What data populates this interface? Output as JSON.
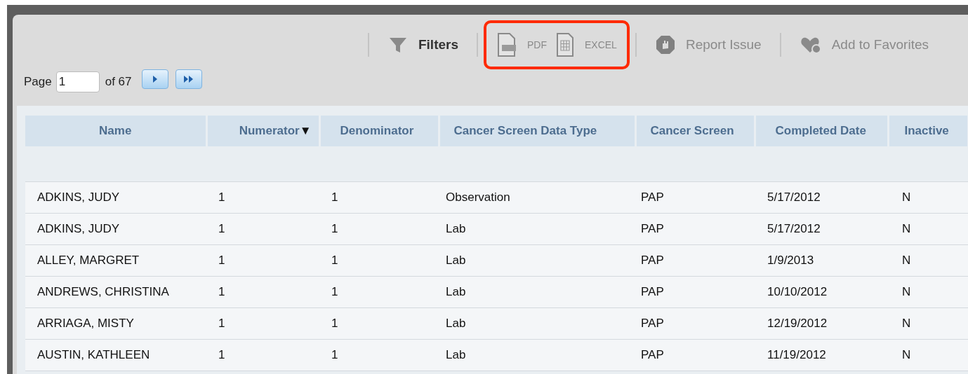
{
  "toolbar": {
    "groups": [
      {
        "highlighted": false,
        "items": [
          {
            "kind": "filter",
            "label": "Filters"
          }
        ]
      },
      {
        "highlighted": true,
        "items": [
          {
            "kind": "pdf",
            "label": "PDF"
          },
          {
            "kind": "excel",
            "label": "EXCEL"
          }
        ]
      },
      {
        "highlighted": false,
        "items": [
          {
            "kind": "report",
            "label": "Report Issue"
          }
        ]
      },
      {
        "highlighted": false,
        "items": [
          {
            "kind": "favorite",
            "label": "Add to Favorites"
          }
        ]
      }
    ]
  },
  "pager": {
    "label": "Page",
    "value": "1",
    "total": "of 67",
    "buttons": [
      {
        "kind": "next"
      },
      {
        "kind": "last"
      }
    ]
  },
  "table": {
    "columns": [
      {
        "label": "Name"
      },
      {
        "label": "Numerator",
        "sort_glyph": "▼"
      },
      {
        "label": "Denominator"
      },
      {
        "label": "Cancer Screen Data Type"
      },
      {
        "label": "Cancer Screen"
      },
      {
        "label": "Completed Date"
      },
      {
        "label": "Inactive"
      }
    ],
    "rows": [
      [
        "ADKINS, JUDY",
        "1",
        "1",
        "Observation",
        "PAP",
        "5/17/2012",
        "N"
      ],
      [
        "ADKINS, JUDY",
        "1",
        "1",
        "Lab",
        "PAP",
        "5/17/2012",
        "N"
      ],
      [
        "ALLEY, MARGRET",
        "1",
        "1",
        "Lab",
        "PAP",
        "1/9/2013",
        "N"
      ],
      [
        "ANDREWS, CHRISTINA",
        "1",
        "1",
        "Lab",
        "PAP",
        "10/10/2012",
        "N"
      ],
      [
        "ARRIAGA, MISTY",
        "1",
        "1",
        "Lab",
        "PAP",
        "12/19/2012",
        "N"
      ],
      [
        "AUSTIN, KATHLEEN",
        "1",
        "1",
        "Lab",
        "PAP",
        "11/19/2012",
        "N"
      ]
    ]
  }
}
